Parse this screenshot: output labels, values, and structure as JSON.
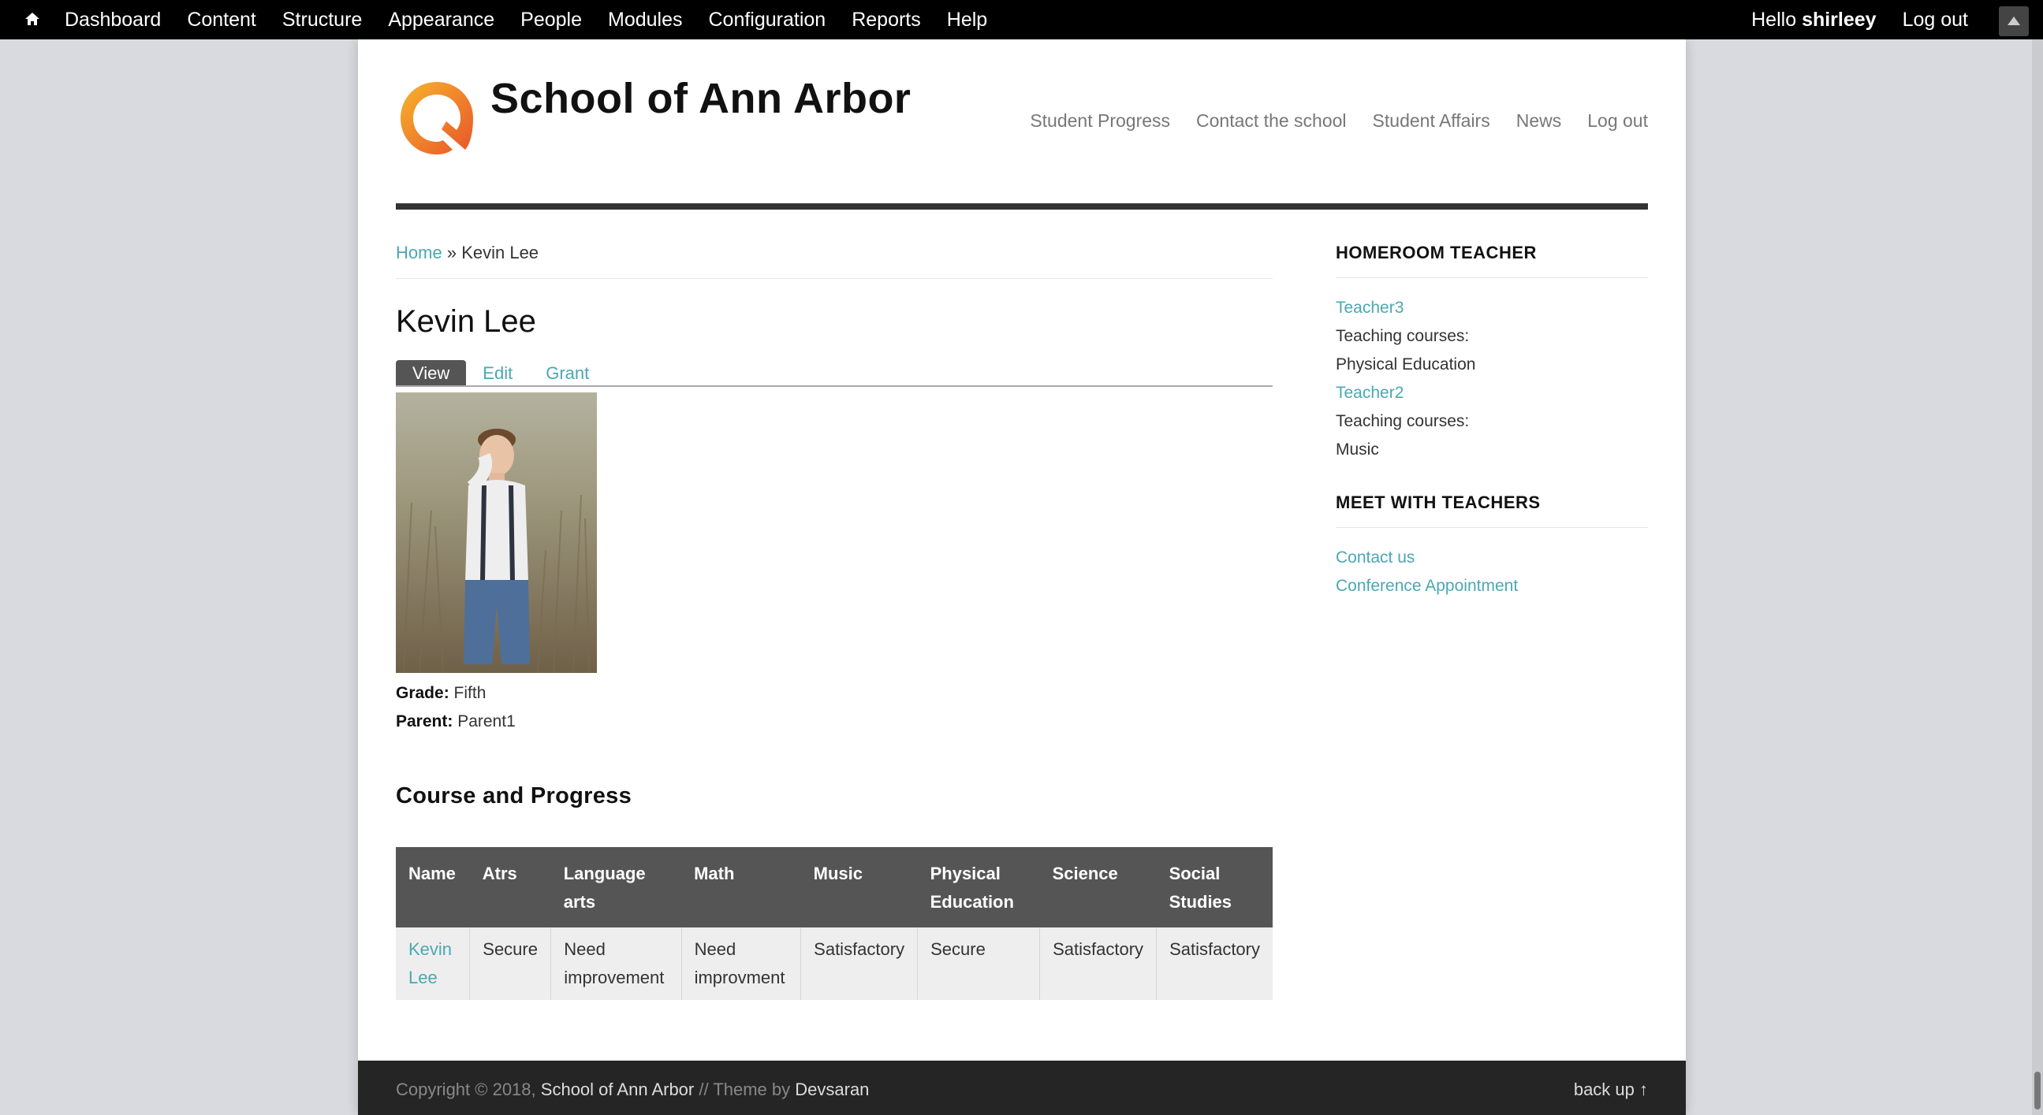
{
  "toolbar": {
    "home_icon": "home-icon",
    "items": [
      "Dashboard",
      "Content",
      "Structure",
      "Appearance",
      "People",
      "Modules",
      "Configuration",
      "Reports",
      "Help"
    ],
    "hello_prefix": "Hello",
    "username": "shirleey",
    "logout": "Log out"
  },
  "header": {
    "site_name": "School of Ann Arbor",
    "logo_icon": "school-logo-icon",
    "menu": [
      "Student Progress",
      "Contact the school",
      "Student Affairs",
      "News",
      "Log out"
    ]
  },
  "breadcrumb": {
    "home": "Home",
    "separator": "»",
    "current": "Kevin Lee"
  },
  "page": {
    "title": "Kevin Lee",
    "tabs": [
      "View",
      "Edit",
      "Grant"
    ],
    "active_tab": "View"
  },
  "student": {
    "grade_label": "Grade:",
    "grade": "Fifth",
    "parent_label": "Parent:",
    "parent": "Parent1"
  },
  "progress": {
    "title": "Course and Progress",
    "headers": [
      "Name",
      "Atrs",
      "Language arts",
      "Math",
      "Music",
      "Physical Education",
      "Science",
      "Social Studies"
    ],
    "rows": [
      [
        "Kevin Lee",
        "Secure",
        "Need improvement",
        "Need improvment",
        "Satisfactory",
        "Secure",
        "Satisfactory",
        "Satisfactory"
      ]
    ]
  },
  "sidebar": {
    "homeroom_title": "HOMEROOM TEACHER",
    "teacher1": "Teacher3",
    "teaching_label": "Teaching courses:",
    "teacher1_course": "Physical Education",
    "teacher2": "Teacher2",
    "teacher2_course": "Music",
    "meet_title": "MEET WITH TEACHERS",
    "contact": "Contact us",
    "conference": "Conference Appointment"
  },
  "footer": {
    "copyright": "Copyright © 2018,",
    "site_link": "School of Ann Arbor",
    "theme_text": "// Theme by",
    "theme_link": "Devsaran",
    "back_up": "back up ↑"
  },
  "colors": {
    "link": "#4aa8b3",
    "toolbar_bg": "#000000",
    "table_header_bg": "#555555",
    "footer_bg": "#252525",
    "logo_orange": "#f0892a"
  }
}
